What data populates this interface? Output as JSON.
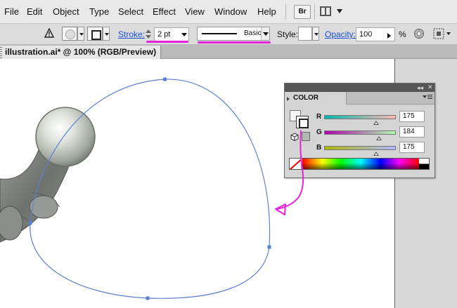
{
  "menubar": {
    "items": [
      "File",
      "Edit",
      "Object",
      "Type",
      "Select",
      "Effect",
      "View",
      "Window",
      "Help"
    ],
    "bridge_label": "Br"
  },
  "controlbar": {
    "stroke_label": "Stroke:",
    "stroke_weight": "2 pt",
    "brush_label": "Basic",
    "style_label": "Style:",
    "opacity_label": "Opacity:",
    "opacity_value": "100",
    "opacity_unit": "%"
  },
  "document": {
    "tab_title": "illustration.ai* @ 100% (RGB/Preview)"
  },
  "color_panel": {
    "title": "COLOR",
    "channels": [
      {
        "label": "R",
        "value": "175",
        "level": 0.686
      },
      {
        "label": "G",
        "value": "184",
        "level": 0.722
      },
      {
        "label": "B",
        "value": "175",
        "level": 0.686
      }
    ],
    "current_color": "#afb8af"
  },
  "colors": {
    "annotation": "#e822d8",
    "path": "#5b7fd0",
    "link": "#1a4fd8"
  },
  "icons": [
    "warning-icon",
    "bridge-icon",
    "arrange-documents-icon",
    "stroke-spinner-icon",
    "recolor-artwork-icon",
    "align-icon",
    "panel-collapse-icon",
    "panel-close-icon",
    "panel-menu-icon",
    "out-of-gamut-cube-icon",
    "none-swatch-icon"
  ]
}
